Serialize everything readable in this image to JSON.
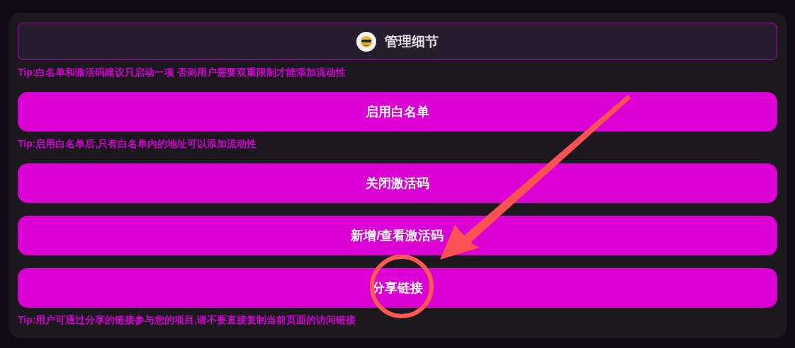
{
  "header": {
    "title": "管理细节"
  },
  "items": [
    {
      "kind": "tip",
      "text": "Tip:白名单和激活码建议只启动一项 否则用户需要双重限制才能添加流动性"
    },
    {
      "kind": "button",
      "label": "启用白名单"
    },
    {
      "kind": "tip",
      "text": "Tip:启用白名单后,只有白名单内的地址可以添加流动性"
    },
    {
      "kind": "button",
      "label": "关闭激活码"
    },
    {
      "kind": "button",
      "label": "新增/查看激活码"
    },
    {
      "kind": "button",
      "label": "分享链接"
    },
    {
      "kind": "tip",
      "text": "Tip:用户可通过分享的链接参与您的项目,请不要直接复制当前页面的访问链接"
    }
  ]
}
